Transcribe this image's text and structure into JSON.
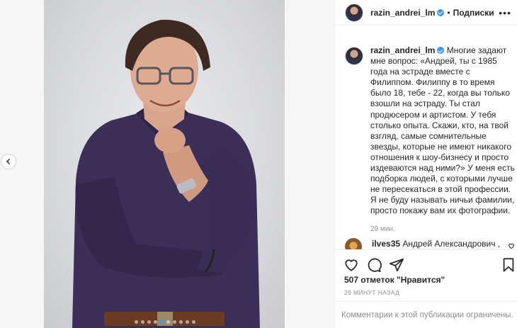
{
  "header": {
    "username": "razin_andrei_lm",
    "separator": "•",
    "follow_label": "Подписки",
    "more_label": "•••"
  },
  "caption": {
    "username": "razin_andrei_lm",
    "text": "Многие задают мне вопрос: «Андрей, ты с 1985 года на эстраде вместе с Филиппом. Филиппу в то время было 18, тебе - 22, когда вы только взошли на эстраду. Ты стал продюсером и артистом. У тебя столько опыта. Скажи, кто, на твой взгляд, самые сомнительные звезды, которые не имеют никакого отношения к шоу-бизнесу и просто издеваются над ними?» У меня есть подборка людей, с которыми лучше не пересекаться в этой профессии. Я не буду называть ничьи фамилии, просто покажу вам их фотографии.",
    "time": "29 мин."
  },
  "reply": {
    "username": "ilves35",
    "text": "Андрей Александрович ,"
  },
  "actions": {
    "likes": "507 отметок \"Нравится\"",
    "posted_ago": "29 МИНУТ НАЗАД"
  },
  "comments_disabled": "Комментарии к этой публикации ограничены.",
  "carousel": {
    "total": 10,
    "active": 4
  },
  "colors": {
    "verified": "#3897f0",
    "muted": "#8e8e8e",
    "shirt": "#3b2f57"
  }
}
